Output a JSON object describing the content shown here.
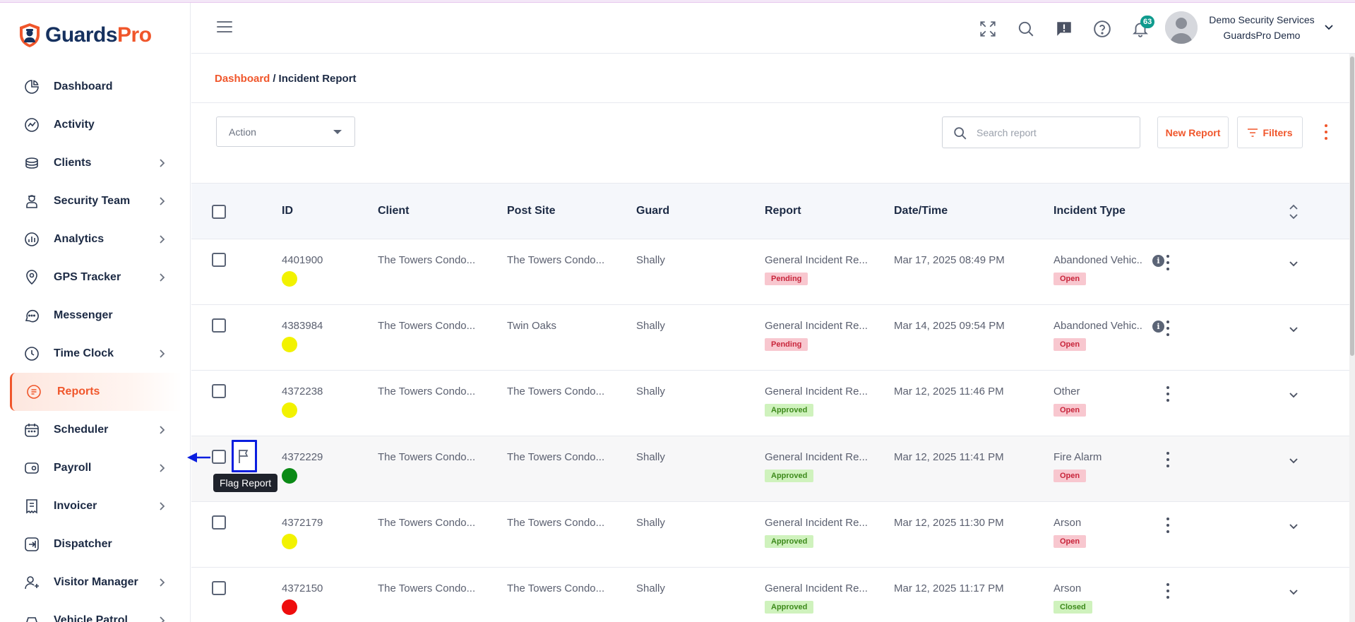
{
  "brand": {
    "name_part1": "Guards",
    "name_part2": "Pro",
    "color_primary": "#16315f",
    "color_accent": "#f0562b"
  },
  "sidebar": {
    "items": [
      {
        "label": "Dashboard",
        "icon": "pie-chart-icon",
        "has_submenu": false
      },
      {
        "label": "Activity",
        "icon": "activity-icon",
        "has_submenu": false
      },
      {
        "label": "Clients",
        "icon": "briefcase-icon",
        "has_submenu": true
      },
      {
        "label": "Security Team",
        "icon": "guard-icon",
        "has_submenu": true
      },
      {
        "label": "Analytics",
        "icon": "analytics-icon",
        "has_submenu": true
      },
      {
        "label": "GPS Tracker",
        "icon": "location-pin-icon",
        "has_submenu": true
      },
      {
        "label": "Messenger",
        "icon": "chat-bubble-icon",
        "has_submenu": false
      },
      {
        "label": "Time Clock",
        "icon": "clock-icon",
        "has_submenu": true
      },
      {
        "label": "Reports",
        "icon": "document-icon",
        "has_submenu": false,
        "active": true
      },
      {
        "label": "Scheduler",
        "icon": "calendar-icon",
        "has_submenu": true
      },
      {
        "label": "Payroll",
        "icon": "wallet-icon",
        "has_submenu": true
      },
      {
        "label": "Invoicer",
        "icon": "invoice-icon",
        "has_submenu": true
      },
      {
        "label": "Dispatcher",
        "icon": "dispatch-icon",
        "has_submenu": false
      },
      {
        "label": "Visitor Manager",
        "icon": "visitor-icon",
        "has_submenu": true
      },
      {
        "label": "Vehicle Patrol",
        "icon": "vehicle-icon",
        "has_submenu": true
      }
    ]
  },
  "header": {
    "notification_count": "63",
    "user_name": "Demo Security Services",
    "user_org": "GuardsPro Demo"
  },
  "breadcrumb": {
    "root": "Dashboard",
    "separator": "/",
    "current": "Incident Report"
  },
  "toolbar": {
    "action_label": "Action",
    "search_placeholder": "Search report",
    "new_report_label": "New Report",
    "filters_label": "Filters"
  },
  "table": {
    "columns": [
      "ID",
      "Client",
      "Post Site",
      "Guard",
      "Report",
      "Date/Time",
      "Incident Type"
    ],
    "rows": [
      {
        "id": "4401900",
        "dot": "#f2f200",
        "client": "The Towers Condo...",
        "post_site": "The Towers Condo...",
        "guard": "Shally",
        "report": "General Incident Re...",
        "report_status": "Pending",
        "report_status_kind": "pending",
        "datetime": "Mar 17, 2025 08:49 PM",
        "incident_type": "Abandoned Vehic..",
        "incident_info": true,
        "incident_status": "Open",
        "incident_status_kind": "open"
      },
      {
        "id": "4383984",
        "dot": "#f2f200",
        "client": "The Towers Condo...",
        "post_site": "Twin Oaks",
        "guard": "Shally",
        "report": "General Incident Re...",
        "report_status": "Pending",
        "report_status_kind": "pending",
        "datetime": "Mar 14, 2025 09:54 PM",
        "incident_type": "Abandoned Vehic..",
        "incident_info": true,
        "incident_status": "Open",
        "incident_status_kind": "open"
      },
      {
        "id": "4372238",
        "dot": "#f2f200",
        "client": "The Towers Condo...",
        "post_site": "The Towers Condo...",
        "guard": "Shally",
        "report": "General Incident Re...",
        "report_status": "Approved",
        "report_status_kind": "approved",
        "datetime": "Mar 12, 2025 11:46 PM",
        "incident_type": "Other",
        "incident_info": false,
        "incident_status": "Open",
        "incident_status_kind": "open"
      },
      {
        "id": "4372229",
        "dot": "#0b8a16",
        "client": "The Towers Condo...",
        "post_site": "The Towers Condo...",
        "guard": "Shally",
        "report": "General Incident Re...",
        "report_status": "Approved",
        "report_status_kind": "approved",
        "datetime": "Mar 12, 2025 11:41 PM",
        "incident_type": "Fire Alarm",
        "incident_info": false,
        "incident_status": "Open",
        "incident_status_kind": "open",
        "hover": true
      },
      {
        "id": "4372179",
        "dot": "#f2f200",
        "client": "The Towers Condo...",
        "post_site": "The Towers Condo...",
        "guard": "Shally",
        "report": "General Incident Re...",
        "report_status": "Approved",
        "report_status_kind": "approved",
        "datetime": "Mar 12, 2025 11:30 PM",
        "incident_type": "Arson",
        "incident_info": false,
        "incident_status": "Open",
        "incident_status_kind": "open"
      },
      {
        "id": "4372150",
        "dot": "#ee0d0d",
        "client": "The Towers Condo...",
        "post_site": "The Towers Condo...",
        "guard": "Shally",
        "report": "General Incident Re...",
        "report_status": "Approved",
        "report_status_kind": "approved",
        "datetime": "Mar 12, 2025 11:17 PM",
        "incident_type": "Arson",
        "incident_info": false,
        "incident_status": "Closed",
        "incident_status_kind": "closed"
      }
    ]
  },
  "flag_tooltip": "Flag Report"
}
